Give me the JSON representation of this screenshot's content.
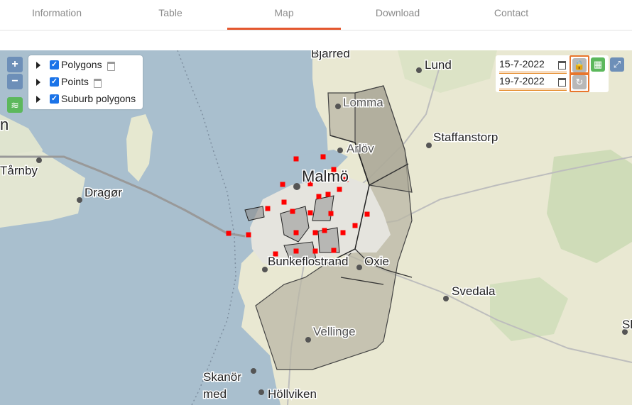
{
  "tabs": [
    {
      "label": "Information",
      "active": false
    },
    {
      "label": "Table",
      "active": false
    },
    {
      "label": "Map",
      "active": true
    },
    {
      "label": "Download",
      "active": false
    },
    {
      "label": "Contact",
      "active": false
    }
  ],
  "zoom": {
    "in": "+",
    "out": "−"
  },
  "layers": [
    {
      "name": "Polygons",
      "checked": true,
      "has_calendar": true
    },
    {
      "name": "Points",
      "checked": true,
      "has_calendar": true
    },
    {
      "name": "Suburb polygons",
      "checked": true,
      "has_calendar": false
    }
  ],
  "date_filter": {
    "start": "15-7-2022",
    "end": "19-7-2022"
  },
  "map_labels": {
    "bjarred": "Bjärred",
    "lund": "Lund",
    "lomma": "Lomma",
    "staffanstorp": "Staffanstorp",
    "arlov": "Arlöv",
    "malmo": "Malmö",
    "tarnby": "Tårnby",
    "dragor": "Dragør",
    "bunkeflostrand": "Bunkeflostrand",
    "oxie": "Oxie",
    "svedala": "Svedala",
    "vellinge": "Vellinge",
    "skanor1": "Skanör",
    "skanor2": "med",
    "hollviken": "Höllviken",
    "left_n": "n",
    "right_s": "Sk"
  },
  "colors": {
    "accent": "#e4572e",
    "point": "#ff0000",
    "water": "#a9bfce",
    "land": "#e9e8d2",
    "button_blue": "#6d8fb8",
    "button_green": "#5cb85c",
    "highlight": "#e8762d"
  }
}
